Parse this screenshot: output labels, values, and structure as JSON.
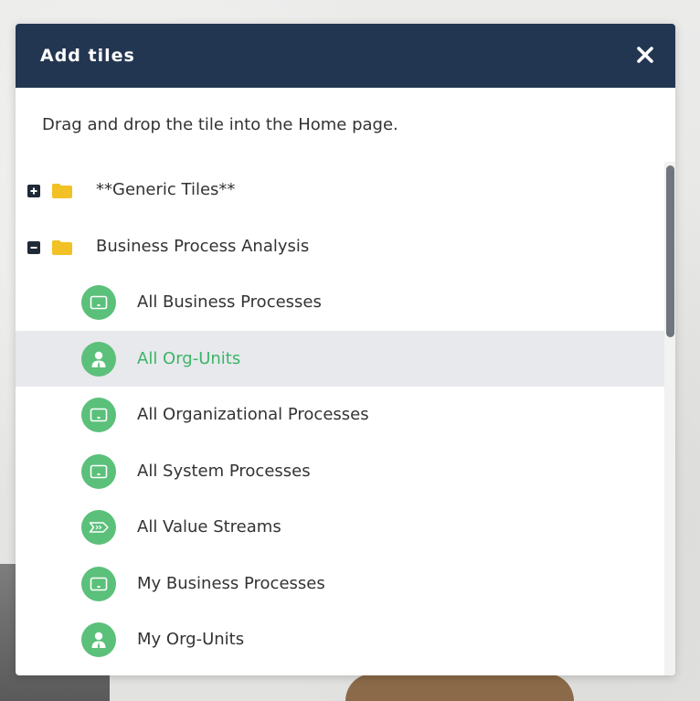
{
  "dialog": {
    "title": "Add tiles",
    "instruction": "Drag and drop the tile into the Home page."
  },
  "tree": {
    "folders": [
      {
        "label": "**Generic Tiles**",
        "expanded": false,
        "toggle_icon": "plus-square-icon",
        "icon": "folder-icon"
      },
      {
        "label": "Business Process Analysis",
        "expanded": true,
        "toggle_icon": "minus-square-icon",
        "icon": "folder-icon"
      }
    ],
    "tiles": [
      {
        "label": "All Business Processes",
        "icon": "monitor-icon",
        "selected": false
      },
      {
        "label": "All Org-Units",
        "icon": "user-icon",
        "selected": true
      },
      {
        "label": "All Organizational Processes",
        "icon": "monitor-icon",
        "selected": false
      },
      {
        "label": "All System Processes",
        "icon": "monitor-icon",
        "selected": false
      },
      {
        "label": "All Value Streams",
        "icon": "value-stream-icon",
        "selected": false
      },
      {
        "label": "My Business Processes",
        "icon": "monitor-icon",
        "selected": false
      },
      {
        "label": "My Org-Units",
        "icon": "user-icon",
        "selected": false
      }
    ]
  },
  "colors": {
    "header": "#233651",
    "tile_icon": "#5bc07a",
    "folder": "#f2c125",
    "selected_text": "#3cb468",
    "selected_row": "#e8e9ec"
  }
}
